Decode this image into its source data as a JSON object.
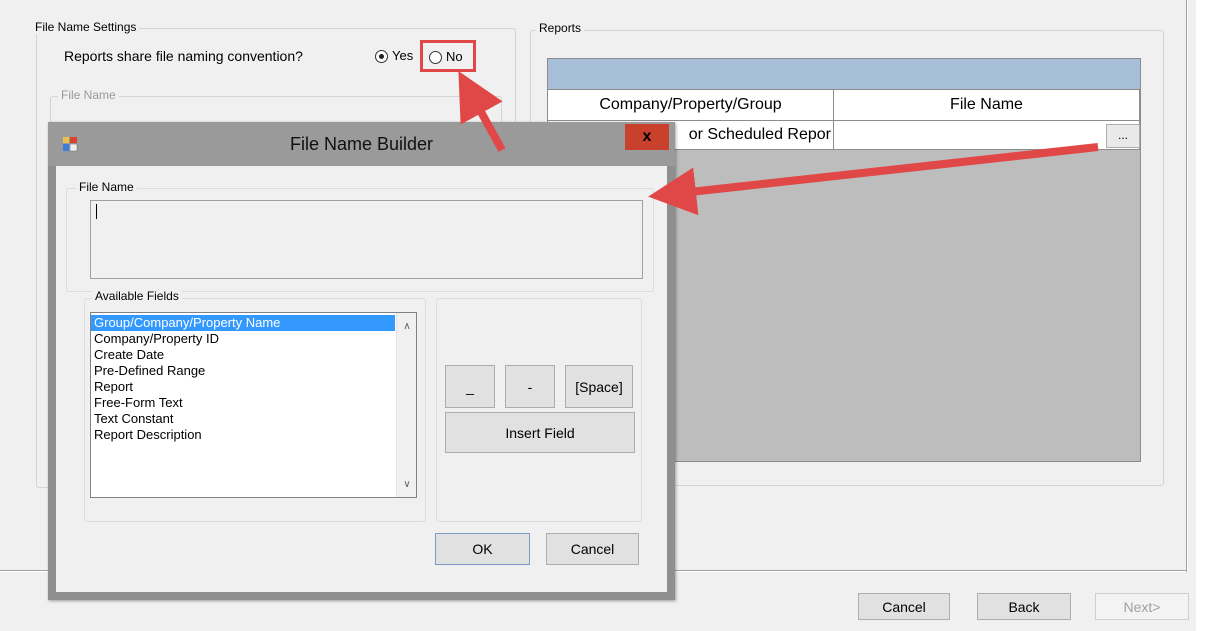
{
  "file_name_settings": {
    "title": "File Name Settings",
    "question": "Reports share file naming convention?",
    "yes_label": "Yes",
    "no_label": "No",
    "yes_selected": true,
    "file_name_group_title": "File Name"
  },
  "reports": {
    "title": "Reports",
    "columns": [
      "Company/Property/Group",
      "File Name"
    ],
    "rows": [
      {
        "company": "or Scheduled Repor",
        "file_name": ""
      }
    ],
    "browse_button": "..."
  },
  "dialog": {
    "title": "File Name Builder",
    "close_label": "x",
    "file_name_group": "File Name",
    "file_name_value": "",
    "available_fields_title": "Available Fields",
    "available_fields": [
      "Group/Company/Property Name",
      "Company/Property ID",
      "Create Date",
      "Pre-Defined Range",
      "Report",
      "Free-Form Text",
      "Text Constant",
      "Report Description"
    ],
    "selected_field_index": 0,
    "underscore_button": "_",
    "dash_button": "-",
    "space_button": "[Space]",
    "insert_field_button": "Insert Field",
    "ok_button": "OK",
    "cancel_button": "Cancel"
  },
  "footer": {
    "cancel": "Cancel",
    "back": "Back",
    "next": "Next>"
  },
  "colors": {
    "highlight": "#e04848",
    "grid_header": "#a7bed8",
    "selection": "#3399ff",
    "close_button": "#c9412c",
    "callout_arrow": "#e04848"
  },
  "icons": {
    "dialog_icon": "app-window-icon",
    "scroll_up": "chevron-up-icon",
    "scroll_down": "chevron-down-icon"
  }
}
